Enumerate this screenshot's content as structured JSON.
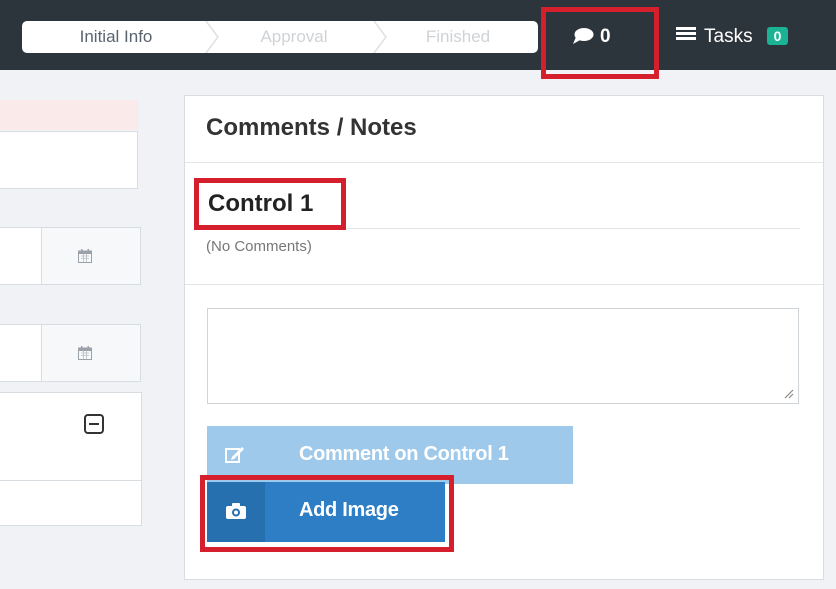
{
  "wizard": {
    "steps": [
      {
        "label": "Initial Info",
        "state": "active"
      },
      {
        "label": "Approval",
        "state": "pending"
      },
      {
        "label": "Finished",
        "state": "pending"
      }
    ]
  },
  "header": {
    "comments_count": "0",
    "comments_icon": "speech-bubble-icon",
    "tasks_label": "Tasks",
    "tasks_icon": "list-icon",
    "tasks_badge": "0",
    "tasks_badge_color": "#1ab394"
  },
  "comments_panel": {
    "title": "Comments / Notes",
    "control_name": "Control 1",
    "empty_text": "(No Comments)",
    "comment_input_value": "",
    "comment_button_label": "Comment on Control 1",
    "add_image_label": "Add Image"
  },
  "colors": {
    "topbar": "#2d353c",
    "highlight": "#d61f2c",
    "primary_button": "#2d7ec4",
    "disabled_button": "#9ec9ea"
  }
}
